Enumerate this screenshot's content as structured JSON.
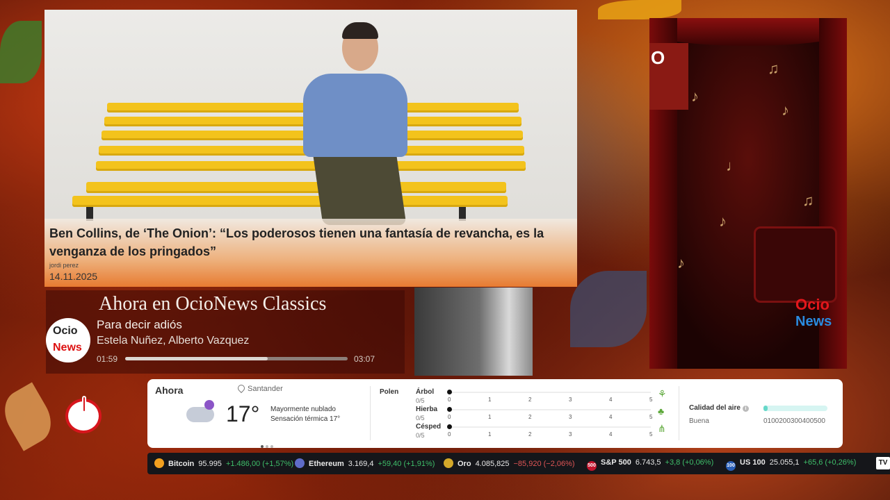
{
  "feature": {
    "headline": "Ben Collins, de ‘The Onion’: “Los poderosos tienen una fantasía de revancha, es la venganza de los pringados”",
    "author": "jordi perez",
    "date": "14.11.2025"
  },
  "player": {
    "heading": "Ahora en OcioNews Classics",
    "logo_top": "Ocio",
    "logo_bottom": "News",
    "song": "Para decir adiós",
    "artist": "Estela Nuñez, Alberto Vazquez",
    "current_time": "01:59",
    "duration": "03:07",
    "progress": 0.64
  },
  "side_logo": {
    "top": "Ocio",
    "bottom": "News"
  },
  "weather": {
    "now_label": "Ahora",
    "location": "Santander",
    "temperature": "17°",
    "description": "Mayormente nublado",
    "feels_like": "Sensación térmica 17°",
    "icon": "partly-cloudy-night-icon",
    "page_dots": 3,
    "active_dot": 0,
    "pollen_label": "Polen",
    "pollen": [
      {
        "name": "Árbol",
        "value": "0/5",
        "level": 0,
        "icon": "tree-icon"
      },
      {
        "name": "Hierba",
        "value": "0/5",
        "level": 0,
        "icon": "weed-icon"
      },
      {
        "name": "Césped",
        "value": "0/5",
        "level": 0,
        "icon": "grass-icon"
      }
    ],
    "pollen_scale": [
      "0",
      "1",
      "2",
      "3",
      "4",
      "5"
    ],
    "air_quality_label": "Calidad del aire",
    "air_quality_value": "Buena",
    "air_quality_scale": "0100200300400500",
    "air_quality_level": 0.06,
    "accent": "#66d8c9"
  },
  "ticker": [
    {
      "name": "Bitcoin",
      "price": "95.995",
      "change": "+1.486,00 (+1,57%)",
      "dir": "up",
      "icon": "bitcoin-icon",
      "color": "#f2a01f"
    },
    {
      "name": "Ethereum",
      "price": "3.169,4",
      "change": "+59,40 (+1,91%)",
      "dir": "up",
      "icon": "ethereum-icon",
      "color": "#5f6cc8"
    },
    {
      "name": "Oro",
      "price": "4.085,825",
      "change": "−85,920 (−2,06%)",
      "dir": "down",
      "icon": "gold-icon",
      "color": "#d4a92a"
    },
    {
      "name": "S&P 500",
      "price": "6.743,5",
      "change": "+3,8 (+0,06%)",
      "dir": "up",
      "icon": "sp500-icon",
      "color": "#c3142d",
      "badge": "500"
    },
    {
      "name": "US 100",
      "price": "25.055,1",
      "change": "+65,6 (+0,26%)",
      "dir": "up",
      "icon": "us100-icon",
      "color": "#2a5fb8",
      "badge": "100"
    }
  ],
  "ticker_brand": "TV"
}
